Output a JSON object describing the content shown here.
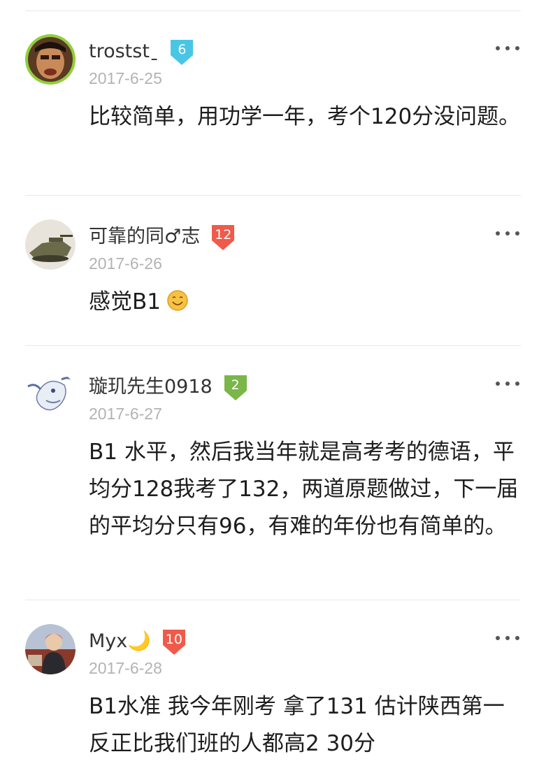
{
  "comments": [
    {
      "username": "troststˍ",
      "level": "6",
      "date": "2017-6-25",
      "text": "比较简单，用功学一年，考个120分没问题。",
      "badge_color": "#49c6e5"
    },
    {
      "username": "可靠的同♂志",
      "level": "12",
      "date": "2017-6-26",
      "text": "感觉B1",
      "badge_color": "#f05a4a",
      "emoji": "smile-emoji"
    },
    {
      "username": "璇玑先生0918",
      "level": "2",
      "date": "2017-6-27",
      "text": "B1 水平，然后我当年就是高考考的德语，平均分128我考了132，两道原题做过，下一届的平均分只有96，有难的年份也有简单的。",
      "badge_color": "#7ab648"
    },
    {
      "username": "Myx🌙",
      "level": "10",
      "date": "2017-6-28",
      "text": "B1水准 我今年刚考 拿了131 估计陕西第一 反正比我们班的人都高2 30分",
      "badge_color": "#f05a4a"
    }
  ]
}
